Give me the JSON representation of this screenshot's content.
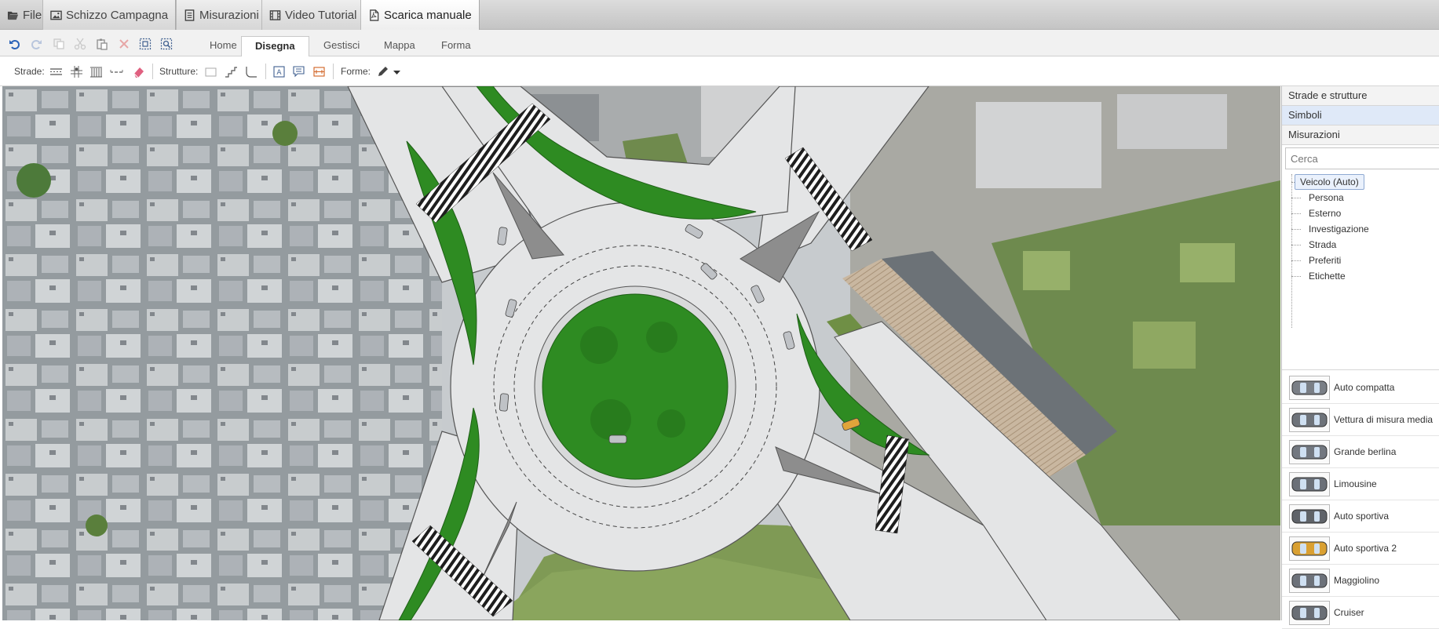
{
  "topbar": {
    "tabs": [
      {
        "label": "File",
        "icon": "folder-open-icon"
      },
      {
        "label": "Schizzo Campagna",
        "icon": "image-icon"
      },
      {
        "label": "Misurazioni",
        "icon": "document-icon"
      },
      {
        "label": "Video Tutorial",
        "icon": "film-icon"
      },
      {
        "label": "Scarica manuale",
        "icon": "pdf-icon"
      }
    ]
  },
  "ribbon": {
    "quick_access": [
      "undo-icon",
      "redo-icon",
      "copy-icon",
      "cut-icon",
      "paste-icon",
      "delete-icon",
      "select-all-icon",
      "zoom-extents-icon"
    ],
    "tabs": [
      "Home",
      "Disegna",
      "Gestisci",
      "Mappa",
      "Forma"
    ],
    "active_tab": "Disegna"
  },
  "toolbar": {
    "strade_label": "Strade:",
    "strutture_label": "Strutture:",
    "forme_label": "Forme:"
  },
  "panel": {
    "sections": [
      "Strade e strutture",
      "Simboli",
      "Misurazioni"
    ],
    "selected_section": "Simboli",
    "search": {
      "placeholder": "Cerca",
      "value": ""
    },
    "tree": [
      "Veicolo (Auto)",
      "Persona",
      "Esterno",
      "Investigazione",
      "Strada",
      "Preferiti",
      "Etichette"
    ],
    "selected_tree_item": "Veicolo (Auto)",
    "vehicles": [
      {
        "label": "Auto compatta",
        "color": "#7a7f86"
      },
      {
        "label": "Vettura di misura media",
        "color": "#6e737a"
      },
      {
        "label": "Grande berlina",
        "color": "#737880"
      },
      {
        "label": "Limousine",
        "color": "#6b7078"
      },
      {
        "label": "Auto sportiva",
        "color": "#5f6369"
      },
      {
        "label": "Auto sportiva 2",
        "color": "#d9a032"
      },
      {
        "label": "Maggiolino",
        "color": "#6d727a"
      },
      {
        "label": "Cruiser",
        "color": "#6a6f76"
      }
    ]
  },
  "colors": {
    "grass": "#2e8b22",
    "road": "#e4e5e6",
    "island": "#8d8d8d",
    "accent": "#3a6fc2"
  }
}
